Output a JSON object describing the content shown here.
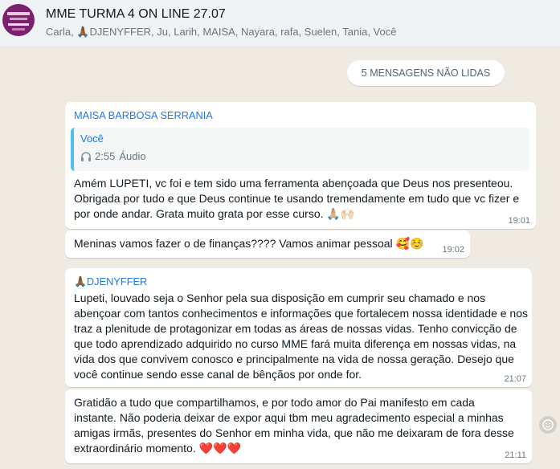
{
  "header": {
    "title": "MME TURMA 4 ON LINE 27.07",
    "participants": "Carla, 🙏🏾DJENYFFER, Ju, Larih, MAISA, Nayara, rafa, Suelen, Tania, Você"
  },
  "unread_badge": "5 MENSAGENS NÃO LIDAS",
  "messages": [
    {
      "sender": "MAISA BARBOSA SERRANIA",
      "quote_author": "Você",
      "quote_duration": "2:55",
      "quote_type": "Áudio",
      "text": "Amém LUPETI, vc foi e tem sido uma ferramenta abençoada que Deus nos presenteou. Obrigada por tudo e que Deus continue te usando tremendamente em tudo que vc fizer e por onde andar. Grata muito grata por esse curso. 🙏🏼🙌🏻",
      "time": "19:01"
    },
    {
      "text": "Meninas vamos fazer o de finanças???? Vamos animar pessoal 🥰☺️",
      "time": "19:02"
    },
    {
      "sender": "🙏🏾DJENYFFER",
      "text": "Lupeti, louvado seja o Senhor pela sua disposição em cumprir seu chamado e nos abençoar com tantos conhecimentos e informações que fortalecem nossa identidade e nos traz a plenitude de protagonizar em todas as áreas de nossas vidas. Tenho convicção de que todo aprendizado adquirido no curso MME fará muita diferença em nossas vidas, na vida dos que convivem conosco e principalmente na vida de nossa geração. Desejo que você continue sendo esse canal de bênçãos por onde for.",
      "time": "21:07"
    },
    {
      "text": "Gratidão a tudo que compartilhamos, e por todo amor do Pai manifesto em cada instante. Não poderia deixar de expor  aqui tbm meu agradecimento especial a minhas amigas irmãs, presentes do Senhor em minha vida, que não me deixaram de fora desse extraordinário momento. ❤️❤️❤️",
      "time": "21:11"
    }
  ],
  "icons": {
    "avatar": "group-avatar",
    "audio": "headphones-icon",
    "reaction": "emoji-reaction-icon"
  },
  "colors": {
    "background": "#efeae2",
    "bubble": "#ffffff",
    "sender": "#1f7aeb",
    "quote_bar": "#53bdeb"
  }
}
